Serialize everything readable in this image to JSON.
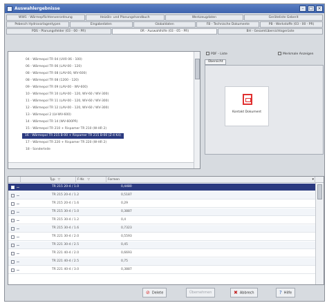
{
  "window": {
    "title": "Auswahlergebnisse"
  },
  "tabs": {
    "row1": [
      "WW1 - Wärmepflichtenverordnung",
      "Heizöls- und Planungshandbuch",
      "Werkzeugdaten",
      "Geräteliste Geberit"
    ],
    "row2": [
      "Pebesch Hydrovorlagentypen",
      "Eingabedaten",
      "Globaldaten",
      "FB - Technische Dokumente",
      "PB - Werkstoffe (03 - 00 - PR)"
    ],
    "row3": [
      "PDS - Planungsfelder (03 - 00 - PR)",
      "0R - Auswahlhilfe (03 - 05 - PR)",
      "BH - Gesamtübersichtsgerüste"
    ],
    "active_row3_index": 1
  },
  "tree": {
    "items": [
      "04 - Wärmepol TR 04 (UV0 06 - 100)",
      "06 - Wärmepol TR 06 (LAV-00 - 120)",
      "08 - Wärmepol TR 08 (LAV-00, WV-600)",
      "08 - Wärmepol TR 08 (1200 - 120)",
      "09 - Wärmepol TR 09 (LAV-00 - WV-600)",
      "10 - Wärmepol TR 10 (LAV-00 - 120, WV-60 / WV-300)",
      "11 - Wärmepol TR 11 (LAV-00 - 120, WV-60 / WV-300)",
      "12 - Wärmepol TR 12 (LAV-00 - 120, WV-60 / WV-300)",
      "13 - Wärmepol 2 (LV-WV-600)",
      "14 - Wärmepol TR 14 (WV-600PR)",
      "15 - Wärmepol TR 210 + Rispamer TR 210 (W-HR 2)",
      "16 - Wärmepol TR 215 B-00 + Rispamer TR 215 B-00 (Z-4 K4)",
      "17 - Wärmepol TR 220 + Rispamer TR 220 (W-HR 2)",
      "18 - Sonderteile"
    ],
    "selected_index": 11
  },
  "right_panel": {
    "toolbar": {
      "left_label": "PDF - Liste",
      "right_label": "Merkmale Anzeigen"
    },
    "tab_label": "Übersicht",
    "document_label": "Kontakt Dokument"
  },
  "grid": {
    "columns": [
      "Typ",
      "F-Nr.",
      "Formen"
    ],
    "rows": [
      {
        "typ": "TR 215 20-4 / 1.0",
        "value": "0,4480"
      },
      {
        "typ": "TR 215 20-4 / 1.2",
        "value": "0,5187"
      },
      {
        "typ": "TR 215 20-4 / 1.6",
        "value": "0,29"
      },
      {
        "typ": "TR 215 30-4 / 1.0",
        "value": "0,3887"
      },
      {
        "typ": "TR 215 30-4 / 1.2",
        "value": "0,4"
      },
      {
        "typ": "TR 215 30-4 / 1.6",
        "value": "0,7323"
      },
      {
        "typ": "TR 221 30-4 / 2.0",
        "value": "0,5593"
      },
      {
        "typ": "TR 221 30-4 / 2.5",
        "value": "0,45"
      },
      {
        "typ": "TR 221 40-4 / 2.0",
        "value": "0,6693"
      },
      {
        "typ": "TR 221 40-4 / 2.5",
        "value": "0,75"
      },
      {
        "typ": "TR 221 40-4 / 3.0",
        "value": "0,3887"
      }
    ],
    "selected_index": 0
  },
  "buttons": {
    "delete": "Delete",
    "apply": "Übernehmen",
    "cancel": "Abbrech",
    "help": "Hilfe"
  },
  "colors": {
    "selection": "#2b3a80",
    "titlebar": "#4a6fb8",
    "delete_icon": "#d83030",
    "cancel_icon": "#c02020",
    "help_icon": "#2a5db0"
  }
}
